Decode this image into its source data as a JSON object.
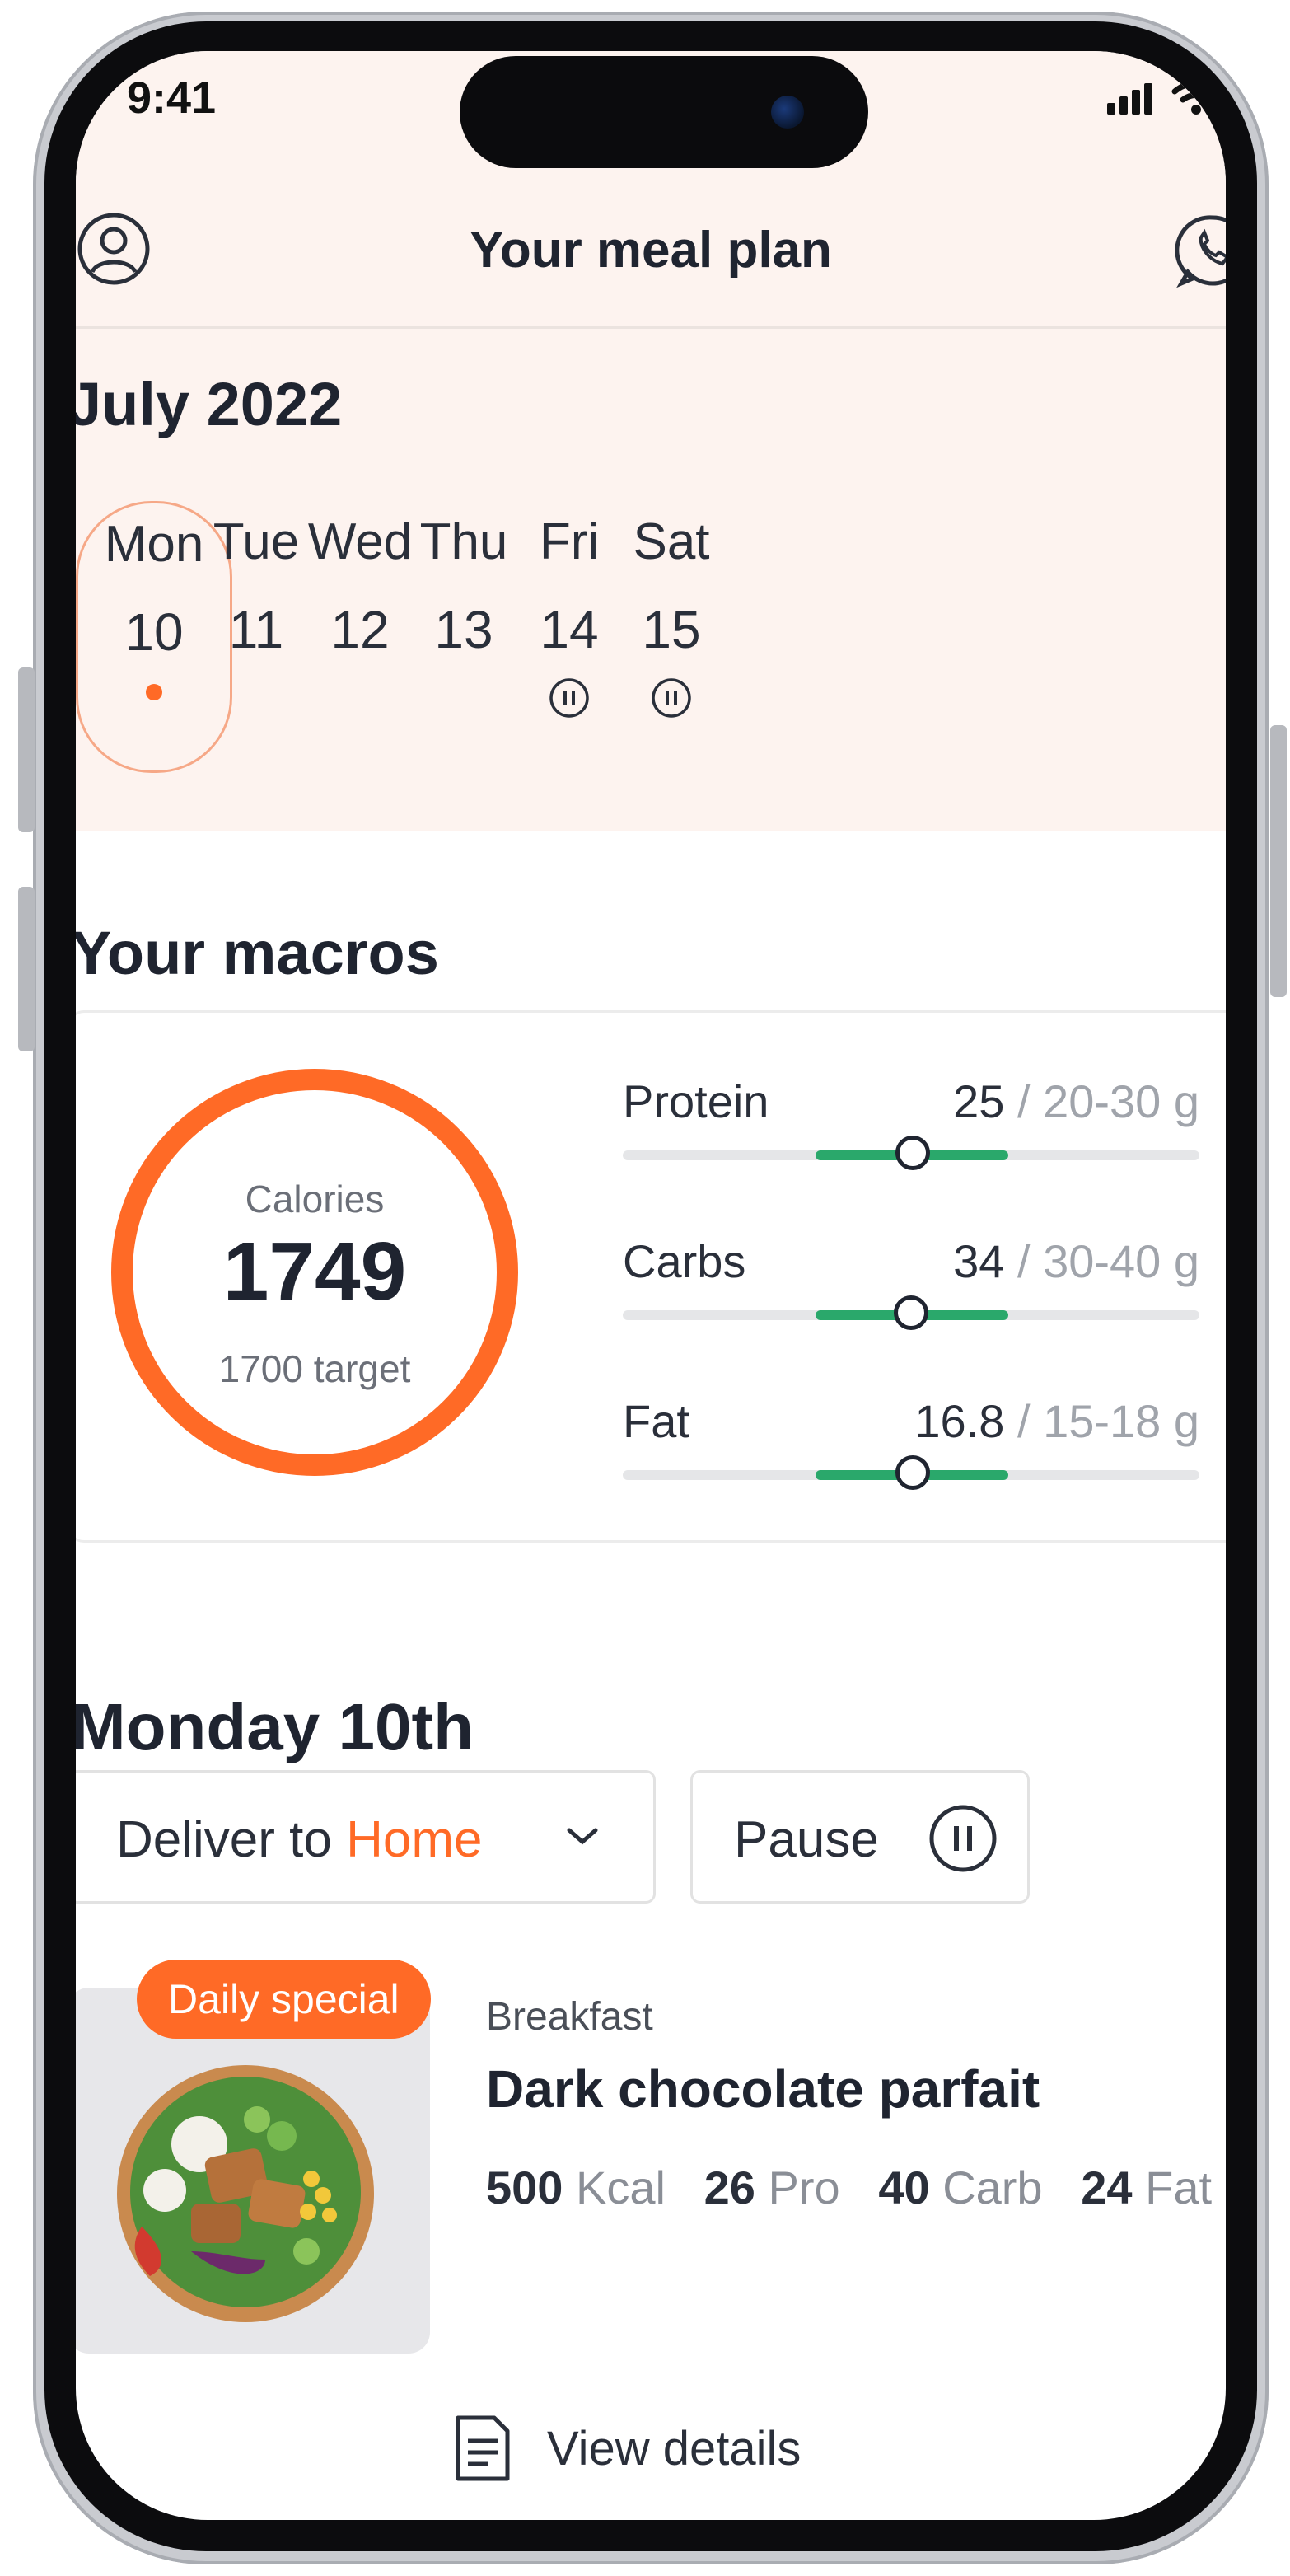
{
  "status_bar": {
    "time": "9:41"
  },
  "header": {
    "title": "Your meal plan"
  },
  "calendar": {
    "month": "July 2022",
    "days": [
      {
        "name": "Mon",
        "date": "10",
        "selected": true,
        "indicator": "dot"
      },
      {
        "name": "Tue",
        "date": "11",
        "indicator": "none"
      },
      {
        "name": "Wed",
        "date": "12",
        "indicator": "none"
      },
      {
        "name": "Thu",
        "date": "13",
        "indicator": "none"
      },
      {
        "name": "Fri",
        "date": "14",
        "indicator": "pause-icon"
      },
      {
        "name": "Sat",
        "date": "15",
        "indicator": "pause-icon"
      }
    ]
  },
  "macros": {
    "title": "Your macros",
    "calories": {
      "label": "Calories",
      "value": "1749",
      "target_label": "1700 target"
    },
    "items": [
      {
        "name": "Protein",
        "value": "25",
        "range": "/ 20-30 g"
      },
      {
        "name": "Carbs",
        "value": "34",
        "range": "/ 30-40 g"
      },
      {
        "name": "Fat",
        "value": "16.8",
        "range": "/ 15-18 g"
      }
    ]
  },
  "day_section": {
    "title": "Monday 10th",
    "deliver_prefix": "Deliver to",
    "deliver_location": "Home",
    "pause_label": "Pause"
  },
  "meal": {
    "badge": "Daily special",
    "category": "Breakfast",
    "name": "Dark chocolate parfait",
    "kcal": "500",
    "kcal_unit": "Kcal",
    "protein": "26",
    "protein_unit": "Pro",
    "carb": "40",
    "carb_unit": "Carb",
    "fat": "24",
    "fat_unit": "Fat",
    "view_details": "View details"
  },
  "colors": {
    "accent": "#ff6a26",
    "green": "#2aa86b",
    "peach_bg": "#fdf3ef",
    "text": "#1f2430"
  }
}
